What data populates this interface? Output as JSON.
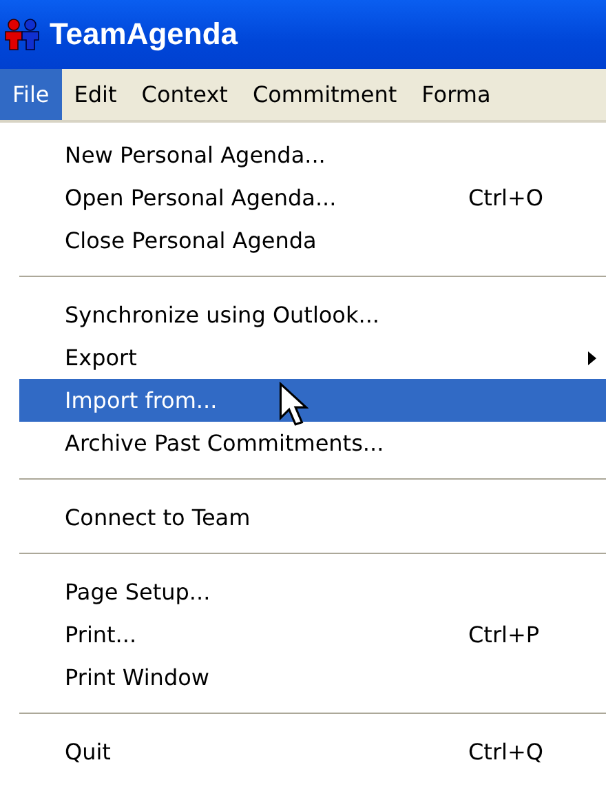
{
  "window": {
    "title": "TeamAgenda"
  },
  "menubar": [
    {
      "label": "File",
      "selected": true
    },
    {
      "label": "Edit",
      "selected": false
    },
    {
      "label": "Context",
      "selected": false
    },
    {
      "label": "Commitment",
      "selected": false
    },
    {
      "label": "Forma",
      "selected": false
    }
  ],
  "menu": [
    {
      "kind": "item",
      "label": "New Personal Agenda...",
      "selected": false
    },
    {
      "kind": "item",
      "label": "Open Personal Agenda...",
      "shortcut": "Ctrl+O",
      "selected": false
    },
    {
      "kind": "item",
      "label": "Close Personal Agenda",
      "selected": false
    },
    {
      "kind": "separator"
    },
    {
      "kind": "item",
      "label": "Synchronize using Outlook...",
      "selected": false
    },
    {
      "kind": "submenu",
      "label": "Export",
      "selected": false
    },
    {
      "kind": "item",
      "label": "Import from...",
      "selected": true
    },
    {
      "kind": "item",
      "label": "Archive Past Commitments...",
      "selected": false
    },
    {
      "kind": "separator"
    },
    {
      "kind": "item",
      "label": "Connect to Team",
      "selected": false
    },
    {
      "kind": "separator"
    },
    {
      "kind": "item",
      "label": "Page Setup...",
      "selected": false
    },
    {
      "kind": "item",
      "label": "Print...",
      "shortcut": "Ctrl+P",
      "selected": false
    },
    {
      "kind": "item",
      "label": "Print Window",
      "selected": false
    },
    {
      "kind": "separator"
    },
    {
      "kind": "item",
      "label": "Quit",
      "shortcut": "Ctrl+Q",
      "selected": false
    }
  ]
}
